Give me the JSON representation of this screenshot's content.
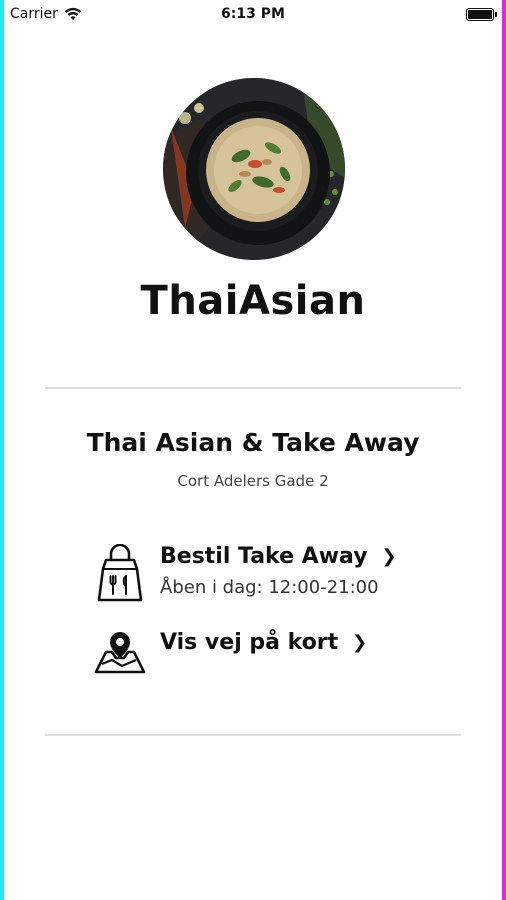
{
  "status_bar": {
    "carrier": "Carrier",
    "time": "6:13 PM"
  },
  "brand": {
    "name": "ThaiAsian"
  },
  "restaurant": {
    "name": "Thai Asian & Take Away",
    "address": "Cort Adelers Gade 2"
  },
  "actions": {
    "order": {
      "title": "Bestil Take Away",
      "hours": "Åben i dag: 12:00-21:00",
      "icon": "takeaway-bag-icon"
    },
    "map": {
      "title": "Vis vej på kort",
      "icon": "map-pin-icon"
    }
  },
  "colors": {
    "edge_left": "#22e6f0",
    "edge_right": "#e91ee9",
    "divider": "#dedede"
  }
}
